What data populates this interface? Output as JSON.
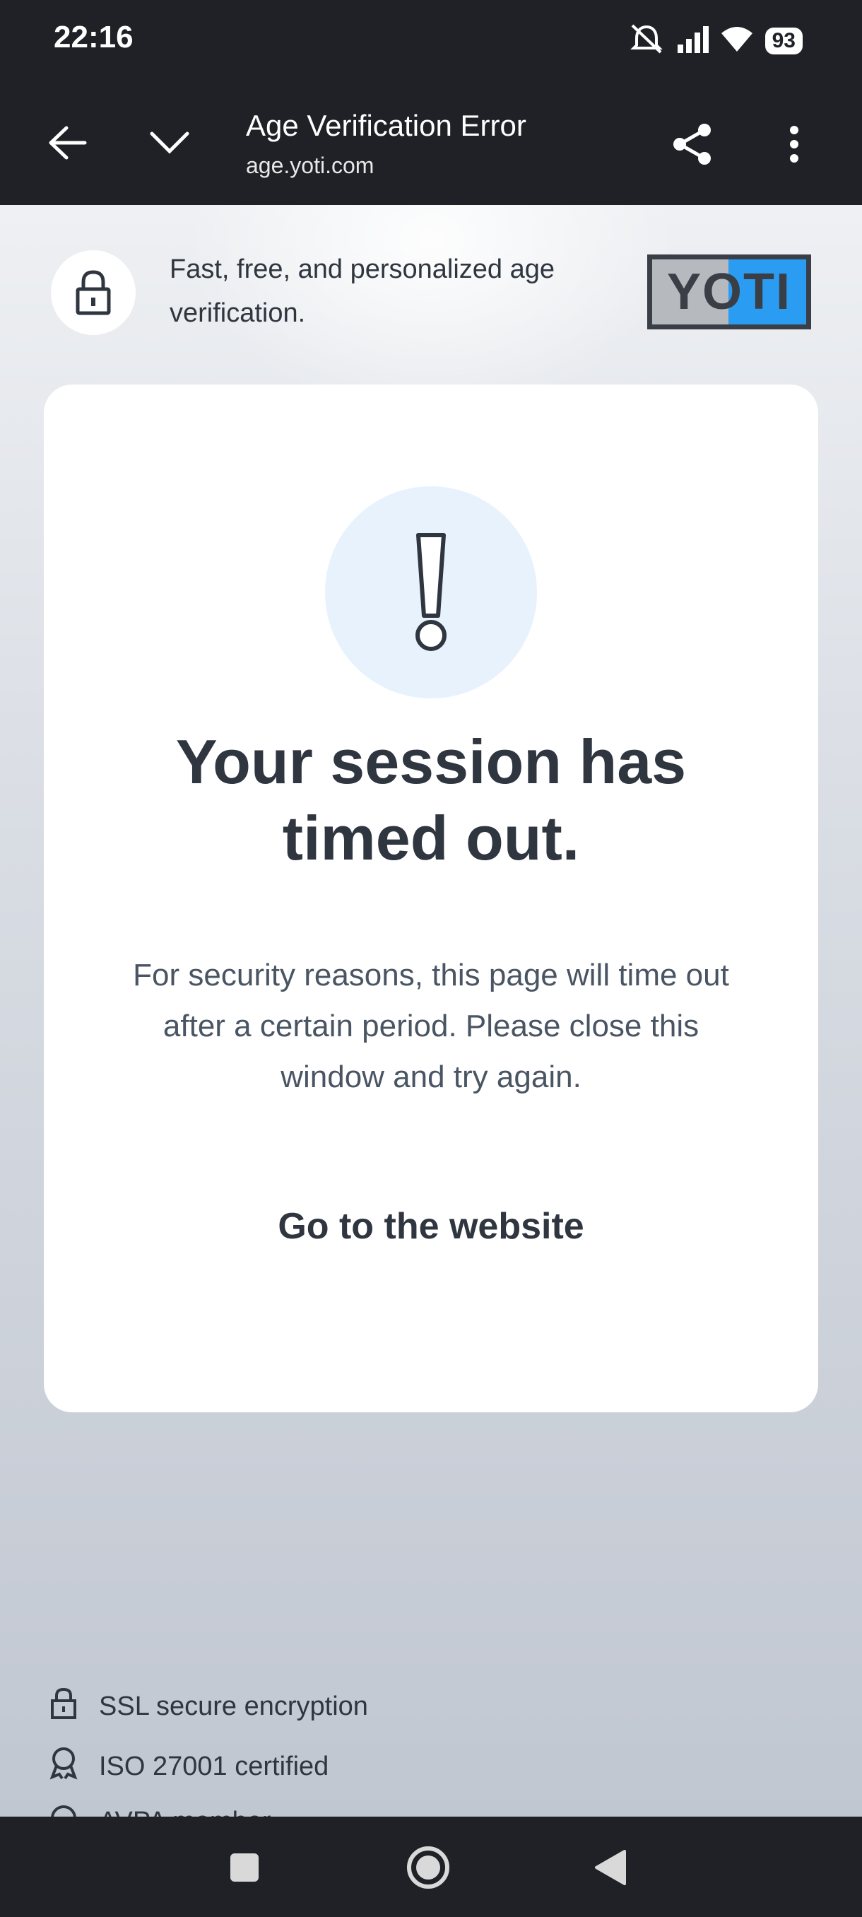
{
  "status_bar": {
    "time": "22:16",
    "battery": "93",
    "icons": [
      "mute-icon",
      "signal-icon",
      "wifi-icon",
      "battery-icon"
    ]
  },
  "toolbar": {
    "title": "Age Verification Error",
    "url": "age.yoti.com",
    "icons": [
      "back-arrow-icon",
      "chevron-down-icon",
      "share-icon",
      "more-vert-icon"
    ]
  },
  "header": {
    "tagline": "Fast, free, and personalized age verification.",
    "logo_text": "YOTI",
    "logo_colors": {
      "left": "#b6b9bd",
      "right": "#2a9cf2",
      "border": "#3a3f47"
    }
  },
  "card": {
    "title": "Your session has timed out.",
    "body": "For security reasons, this page will time out after a certain period. Please close this window and try again.",
    "link": "Go to the website",
    "alert_bg": "#e7f2fd"
  },
  "trust": {
    "items": [
      {
        "label": "SSL secure encryption",
        "icon": "lock-icon"
      },
      {
        "label": "ISO 27001 certified",
        "icon": "award-icon"
      },
      {
        "label": "AVPA member",
        "icon": "circle-icon"
      }
    ]
  },
  "nav": {
    "icons": [
      "recents-square-icon",
      "home-circle-icon",
      "back-triangle-icon"
    ]
  }
}
